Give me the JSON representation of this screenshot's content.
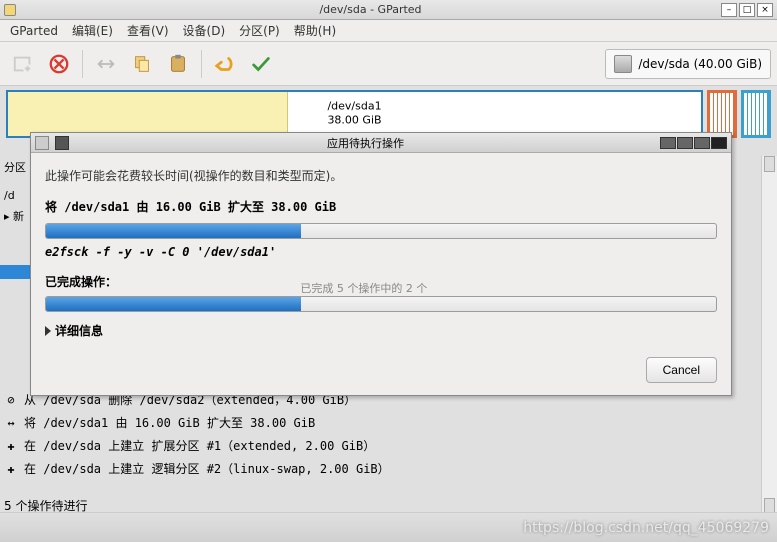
{
  "window": {
    "title": "/dev/sda - GParted"
  },
  "menubar": {
    "gparted": "GParted",
    "edit": "编辑(E)",
    "view": "查看(V)",
    "device": "设备(D)",
    "partition": "分区(P)",
    "help": "帮助(H)"
  },
  "device_select": "/dev/sda  (40.00 GiB)",
  "diskmap": {
    "partition": "/dev/sda1",
    "size": "38.00 GiB"
  },
  "side": {
    "col": "分区",
    "d": "/d",
    "new": "▸ 新"
  },
  "ops": [
    "从 /dev/sda 删除 /dev/sda2（extended，4.00 GiB）",
    "将 /dev/sda1 由 16.00 GiB 扩大至 38.00 GiB",
    "在 /dev/sda 上建立 扩展分区 #1（extended, 2.00 GiB）",
    "在 /dev/sda 上建立 逻辑分区 #2（linux-swap, 2.00 GiB）"
  ],
  "footer": "5 个操作待进行",
  "dialog": {
    "title": "应用待执行操作",
    "warning": "此操作可能会花费较长时间(视操作的数目和类型而定)。",
    "operation": "将 /dev/sda1 由 16.00 GiB 扩大至 38.00 GiB",
    "command": "e2fsck -f -y -v -C 0 '/dev/sda1'",
    "completed_label": "已完成操作：",
    "progress_text": "已完成 5 个操作中的 2 个",
    "details": "详细信息",
    "cancel": "Cancel"
  },
  "watermark": "https://blog.csdn.net/qq_45069279"
}
